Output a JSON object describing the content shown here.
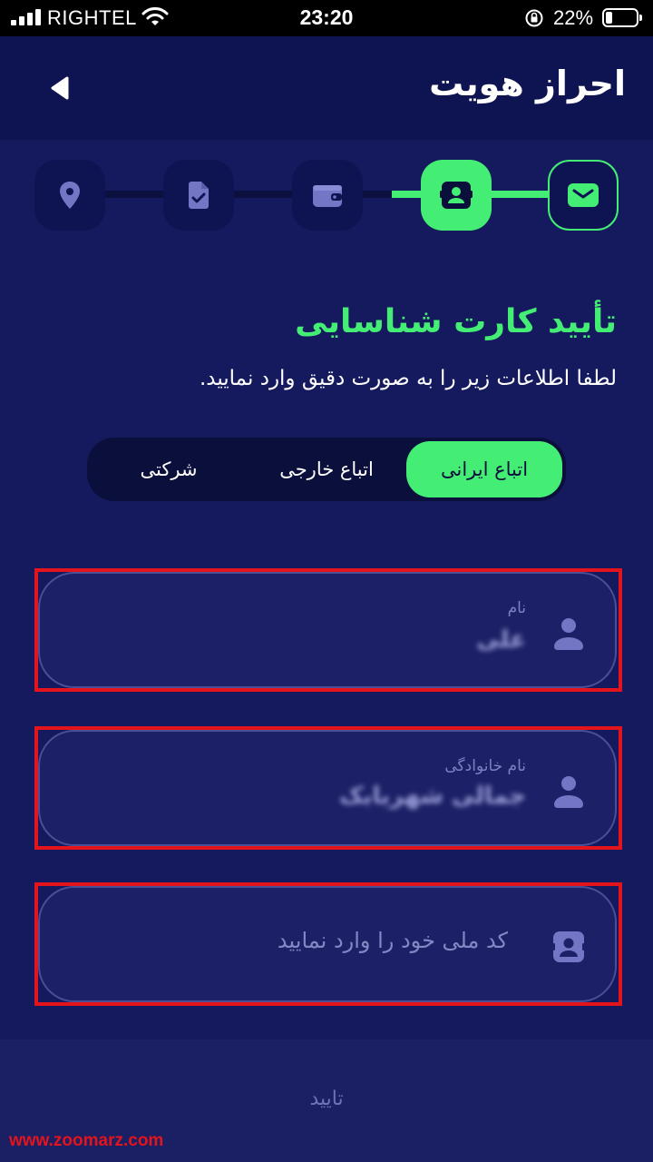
{
  "status_bar": {
    "carrier": "RIGHTEL",
    "time": "23:20",
    "battery": "22%"
  },
  "header": {
    "title": "احراز هویت"
  },
  "steps": [
    {
      "icon": "envelope-icon",
      "state": "done"
    },
    {
      "icon": "id-card-icon",
      "state": "current"
    },
    {
      "icon": "wallet-icon",
      "state": "pending"
    },
    {
      "icon": "document-check-icon",
      "state": "pending"
    },
    {
      "icon": "location-pin-icon",
      "state": "pending"
    }
  ],
  "section": {
    "title": "تأیید کارت شناسایی",
    "subtitle": "لطفا اطلاعات زیر را به صورت دقیق وارد نمایید."
  },
  "segments": {
    "iranian": "اتباع ایرانی",
    "foreign": "اتباع خارجی",
    "company": "شرکتی",
    "selected": "اتباع ایرانی"
  },
  "fields": {
    "first_name": {
      "label": "نام",
      "value": "علی"
    },
    "last_name": {
      "label": "نام خانوادگی",
      "value": "جمالی شهربابک"
    },
    "national_code": {
      "placeholder": "کد ملی خود را وارد نمایید"
    }
  },
  "footer": {
    "confirm_label": "تایید"
  },
  "watermark": "www.zoomarz.com",
  "colors": {
    "accent": "#44ee74",
    "background": "#151a5e",
    "header": "#0e1352",
    "highlight_box": "#e3141c"
  }
}
